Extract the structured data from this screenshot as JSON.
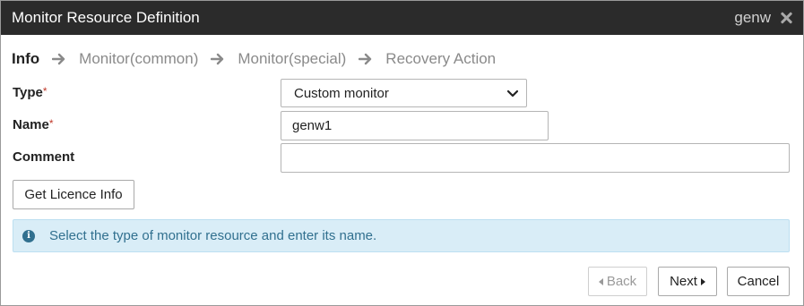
{
  "window": {
    "title": "Monitor Resource Definition",
    "resource_name": "genw"
  },
  "steps": [
    "Info",
    "Monitor(common)",
    "Monitor(special)",
    "Recovery Action"
  ],
  "form": {
    "type_label": "Type",
    "type_value": "Custom monitor",
    "name_label": "Name",
    "name_value": "genw1",
    "comment_label": "Comment",
    "comment_value": "",
    "required_mark": "*"
  },
  "buttons": {
    "licence": "Get Licence Info",
    "back": "Back",
    "next": "Next",
    "cancel": "Cancel"
  },
  "info_message": "Select the type of monitor resource and enter its name.",
  "colors": {
    "titlebar": "#2b2b2b",
    "info_bg": "#d9edf7",
    "info_text": "#31708f",
    "required": "#c0392b"
  }
}
